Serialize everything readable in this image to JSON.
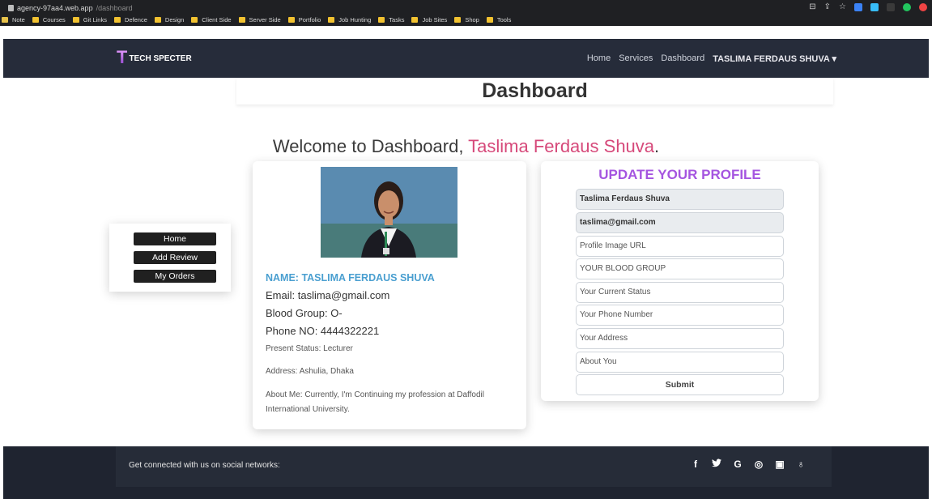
{
  "browser": {
    "domain": "agency-97aa4.web.app",
    "path": "/dashboard",
    "bookmarks": [
      "Note",
      "Courses",
      "Git Links",
      "Defence",
      "Design",
      "Client Side",
      "Server Side",
      "Portfolio",
      "Job Hunting",
      "Tasks",
      "Job Sites",
      "Shop",
      "Tools"
    ]
  },
  "navbar": {
    "brand": "TECH SPECTER",
    "links": [
      "Home",
      "Services",
      "Dashboard"
    ],
    "user": "TASLIMA FERDAUS SHUVA ▾"
  },
  "page": {
    "title": "Dashboard",
    "welcome_prefix": "Welcome to Dashboard, ",
    "welcome_name": "Taslima Ferdaus Shuva",
    "welcome_suffix": "."
  },
  "side_menu": [
    "Home",
    "Add Review",
    "My Orders"
  ],
  "profile": {
    "name": "NAME: TASLIMA FERDAUS SHUVA",
    "email": "Email: taslima@gmail.com",
    "blood": "Blood Group: O-",
    "phone": "Phone NO: 4444322221",
    "status": "Present Status: Lecturer",
    "address": "Address: Ashulia, Dhaka",
    "about": "About Me: Currently, I'm Continuing my profession at Daffodil International University."
  },
  "update_form": {
    "title": "UPDATE YOUR PROFILE",
    "name_value": "Taslima Ferdaus Shuva",
    "email_value": "taslima@gmail.com",
    "placeholders": [
      "Profile Image URL",
      "YOUR BLOOD GROUP",
      "Your Current Status",
      "Your Phone Number",
      "Your Address",
      "About You"
    ],
    "submit": "Submit"
  },
  "footer": {
    "text": "Get connected with us on social networks:",
    "icons": [
      "f",
      "🐦",
      "G",
      "◎",
      "▣",
      "♁"
    ]
  }
}
